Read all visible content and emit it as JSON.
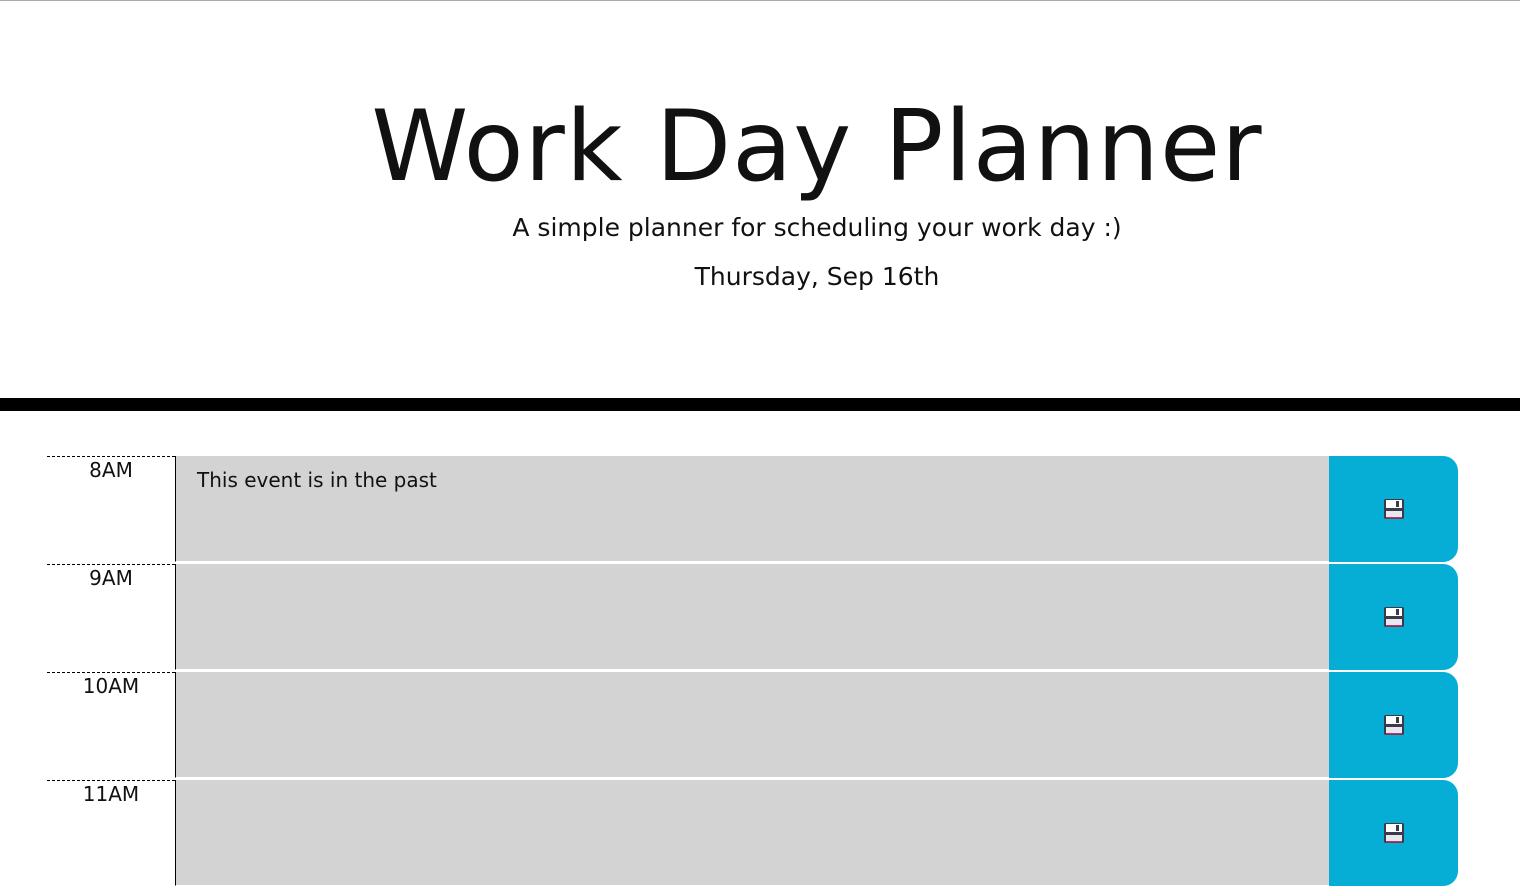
{
  "header": {
    "title": "Work Day Planner",
    "subtitle": "A simple planner for scheduling your work day :)",
    "current_date": "Thursday, Sep 16th"
  },
  "colors": {
    "past": "#d3d3d3",
    "save_button": "#06aed5",
    "divider": "#000000"
  },
  "rows": [
    {
      "hour": "8AM",
      "text": "This event is in the past",
      "status": "past",
      "icon": "floppy-disk-icon"
    },
    {
      "hour": "9AM",
      "text": "",
      "status": "past",
      "icon": "floppy-disk-icon"
    },
    {
      "hour": "10AM",
      "text": "",
      "status": "past",
      "icon": "floppy-disk-icon"
    },
    {
      "hour": "11AM",
      "text": "",
      "status": "past",
      "icon": "floppy-disk-icon"
    }
  ]
}
